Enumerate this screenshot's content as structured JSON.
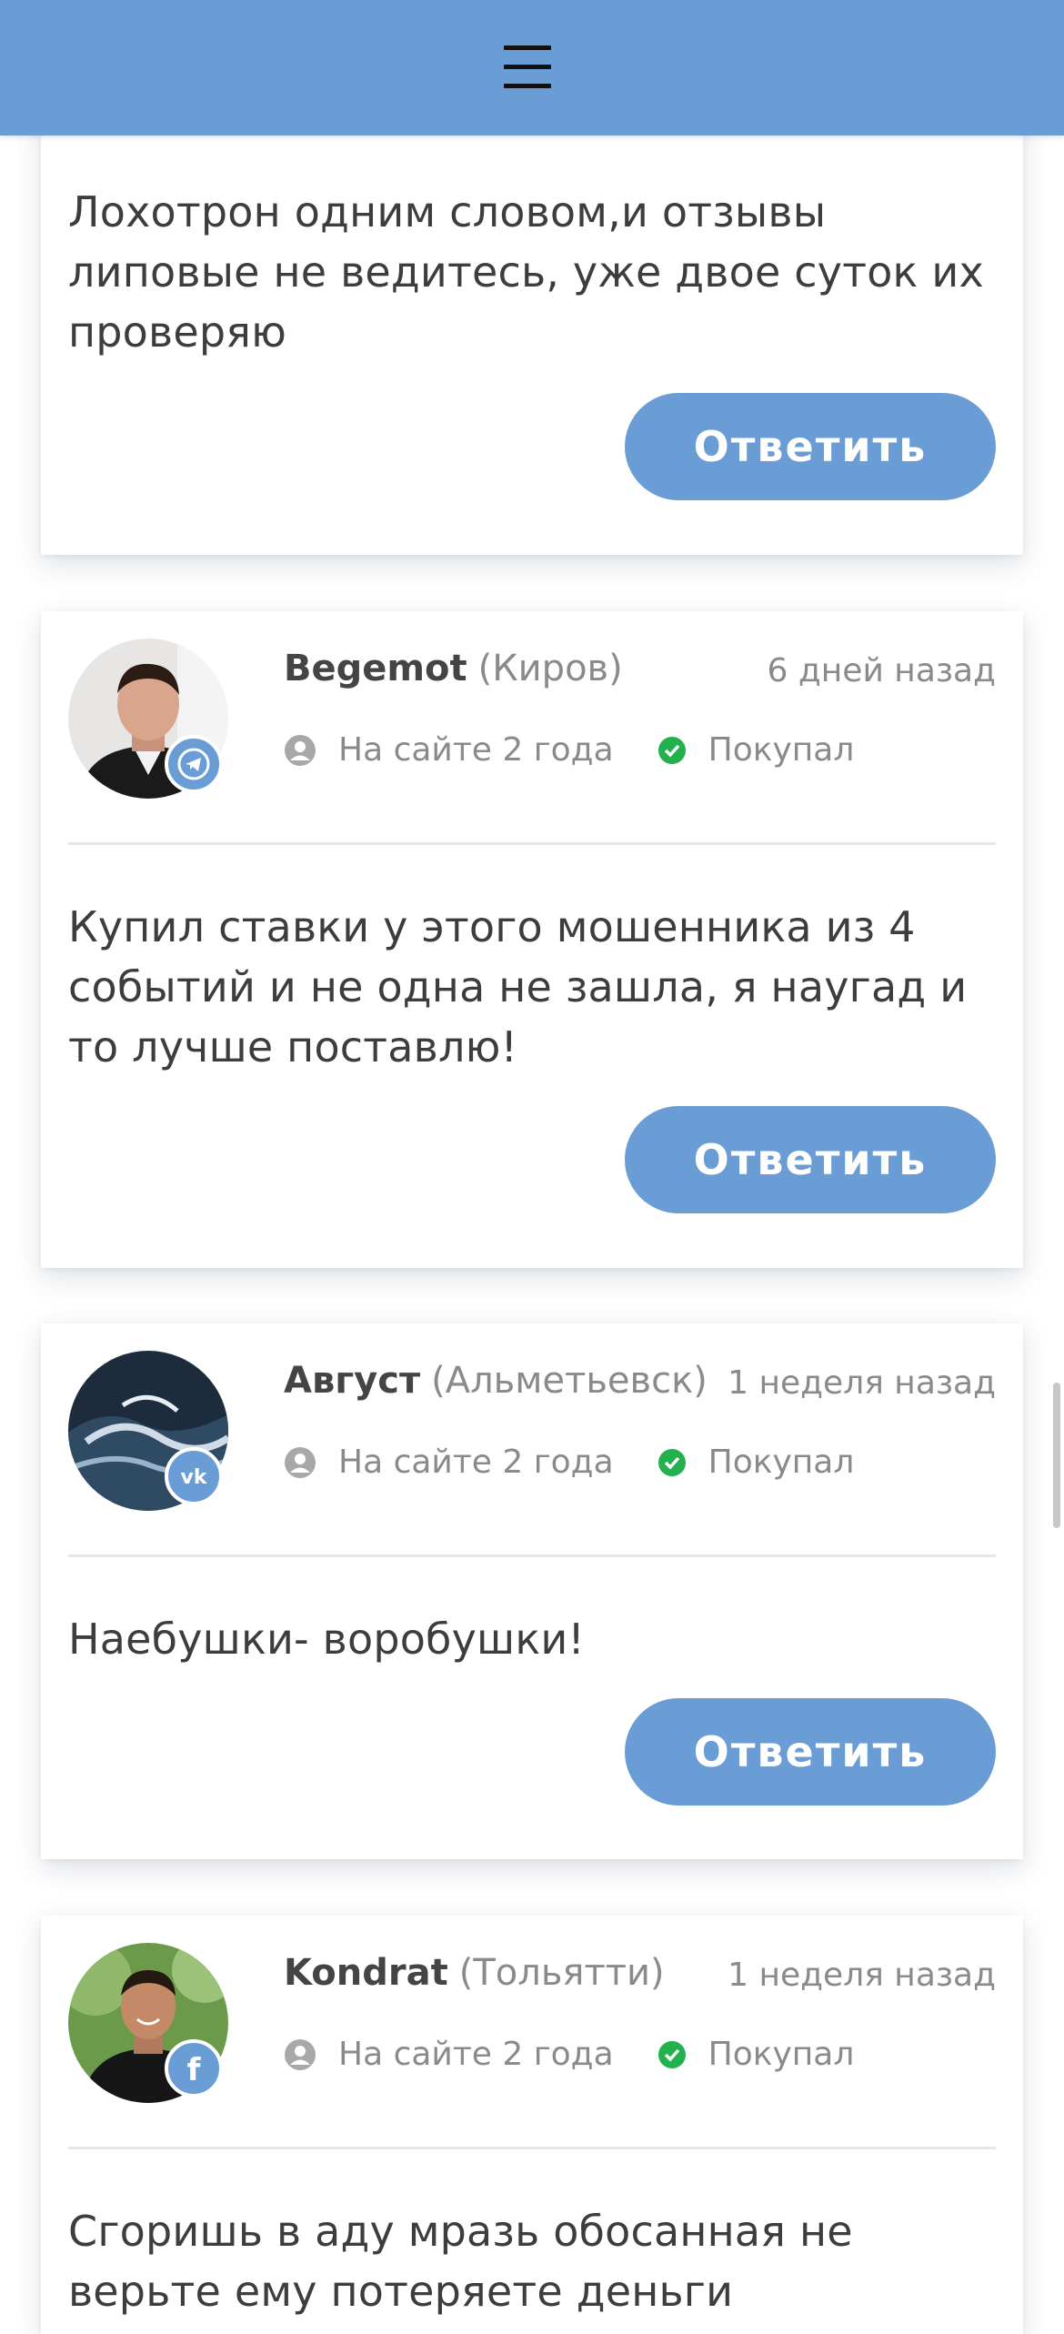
{
  "header": {
    "menu_icon": "hamburger-menu-icon",
    "background": "#6a9cd6"
  },
  "reply_label": "Ответить",
  "comments": [
    {
      "text": "Лохотрон одним словом,и отзывы липовые не ведитесь, уже двое суток их проверяю"
    },
    {
      "author": "Begemot",
      "city": "(Киров)",
      "time": "6 дней назад",
      "member_since": "На сайте 2 года",
      "status": "Покупал",
      "social": "telegram-icon",
      "text": "Купил ставки у этого мошенника из 4 событий и не одна не зашла, я наугад и то лучше поставлю!"
    },
    {
      "author": "Август",
      "city": "(Альметьевск)",
      "time": "1 неделя назад",
      "member_since": "На сайте 2 года",
      "status": "Покупал",
      "social": "vk-icon",
      "text": "Наебушки- воробушки!"
    },
    {
      "author": "Kondrat",
      "city": "(Тольятти)",
      "time": "1 неделя назад",
      "member_since": "На сайте 2 года",
      "status": "Покупал",
      "social": "facebook-icon",
      "text": "Сгоришь в аду мразь обосанная не верьте ему потеряете деньги"
    }
  ],
  "colors": {
    "accent": "#6a9cd6",
    "check": "#22b14c",
    "muted": "#8a8a8a"
  }
}
